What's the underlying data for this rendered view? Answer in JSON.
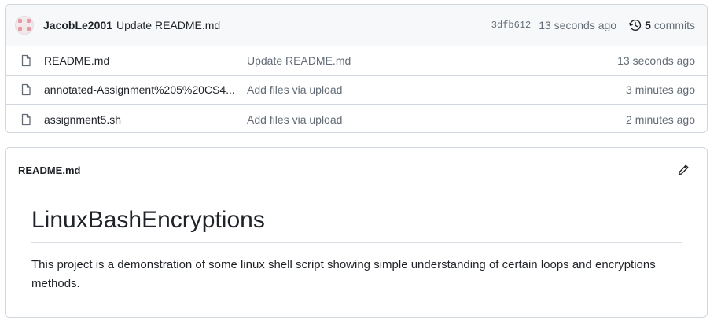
{
  "commit": {
    "author": "JacobLe2001",
    "message": "Update README.md",
    "sha": "3dfb612",
    "time": "13 seconds ago",
    "commits_count": "5",
    "commits_label": "commits"
  },
  "files": [
    {
      "name": "README.md",
      "commit_message": "Update README.md",
      "time": "13 seconds ago",
      "icon": "file-icon"
    },
    {
      "name": "annotated-Assignment%205%20CS4...",
      "commit_message": "Add files via upload",
      "time": "3 minutes ago",
      "icon": "file-icon"
    },
    {
      "name": "assignment5.sh",
      "commit_message": "Add files via upload",
      "time": "2 minutes ago",
      "icon": "file-icon"
    }
  ],
  "readme": {
    "filename": "README.md",
    "heading": "LinuxBashEncryptions",
    "paragraph": "This project is a demonstration of some linux shell script showing simple understanding of certain loops and encryptions methods.",
    "edit_icon": "pencil-icon"
  },
  "colors": {
    "border": "#d0d7de",
    "header_bg": "#f6f8fa",
    "muted_text": "#636c76",
    "text": "#1f2328",
    "avatar_accent": "#e69aa6"
  }
}
